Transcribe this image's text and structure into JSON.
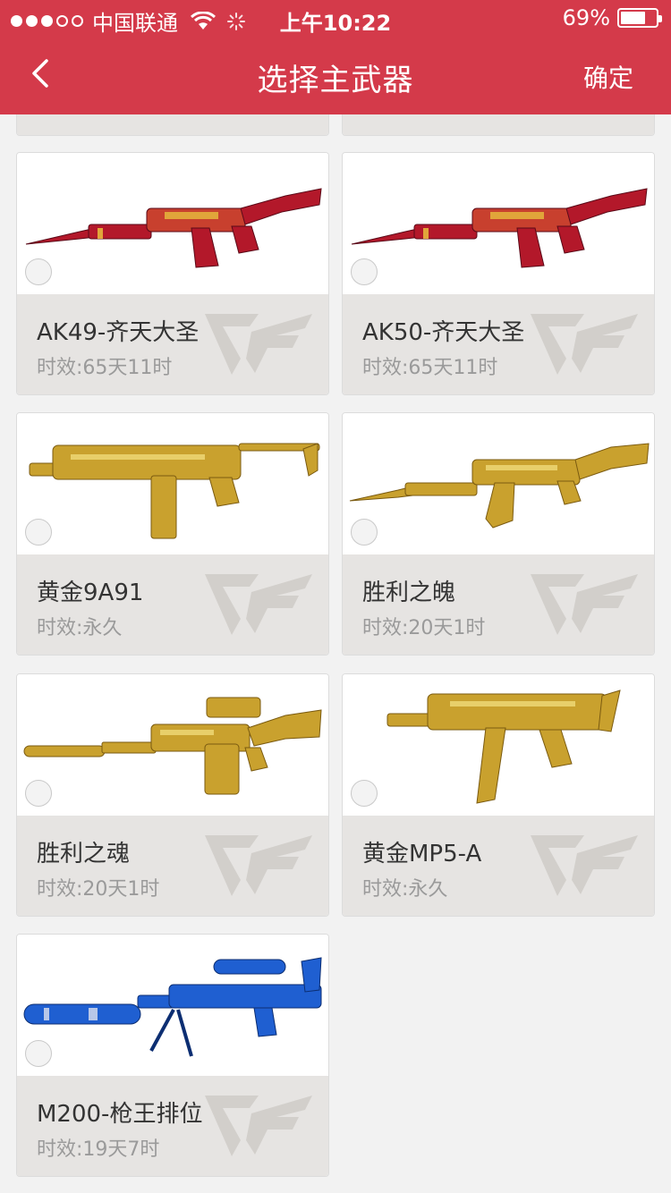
{
  "status_bar": {
    "signal_dots": [
      true,
      true,
      true,
      false,
      false
    ],
    "carrier": "中国联通",
    "time": "上午10:22",
    "battery_percent": "69%",
    "battery_level": 0.69
  },
  "nav": {
    "back_icon": "chevron-left-icon",
    "title": "选择主武器",
    "confirm_label": "确定"
  },
  "colors": {
    "accent": "#d43a4a",
    "card_info_bg": "#e6e4e2",
    "gold": "#c9a12e",
    "red_skin": "#b3182a",
    "blue_skin": "#1f5fd1"
  },
  "weapons": [
    {
      "name": "AK49-齐天大圣",
      "duration": "时效:65天11时",
      "skin": "ak-red"
    },
    {
      "name": "AK50-齐天大圣",
      "duration": "时效:65天11时",
      "skin": "ak-red"
    },
    {
      "name": "黄金9A91",
      "duration": "时效:永久",
      "skin": "smg-gold"
    },
    {
      "name": "胜利之魄",
      "duration": "时效:20天1时",
      "skin": "ak-gold"
    },
    {
      "name": "胜利之魂",
      "duration": "时效:20天1时",
      "skin": "m4-gold"
    },
    {
      "name": "黄金MP5-A",
      "duration": "时效:永久",
      "skin": "mp5-gold"
    },
    {
      "name": "M200-枪王排位",
      "duration": "时效:19天7时",
      "skin": "sniper-blue"
    }
  ]
}
